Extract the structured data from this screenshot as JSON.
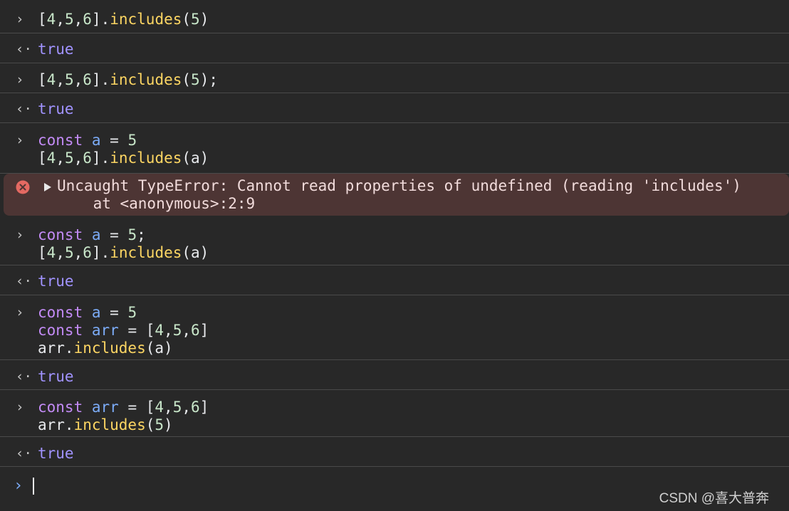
{
  "entries": [
    {
      "type": "input",
      "lines": [
        [
          {
            "t": "[",
            "c": "plain"
          },
          {
            "t": "4",
            "c": "num"
          },
          {
            "t": ",",
            "c": "plain"
          },
          {
            "t": "5",
            "c": "num"
          },
          {
            "t": ",",
            "c": "plain"
          },
          {
            "t": "6",
            "c": "num"
          },
          {
            "t": "].",
            "c": "plain"
          },
          {
            "t": "includes",
            "c": "fn"
          },
          {
            "t": "(",
            "c": "plain"
          },
          {
            "t": "5",
            "c": "num"
          },
          {
            "t": ")",
            "c": "plain"
          }
        ]
      ]
    },
    {
      "type": "result",
      "lines": [
        [
          {
            "t": "true",
            "c": "bool"
          }
        ]
      ]
    },
    {
      "type": "input",
      "lines": [
        [
          {
            "t": "[",
            "c": "plain"
          },
          {
            "t": "4",
            "c": "num"
          },
          {
            "t": ",",
            "c": "plain"
          },
          {
            "t": "5",
            "c": "num"
          },
          {
            "t": ",",
            "c": "plain"
          },
          {
            "t": "6",
            "c": "num"
          },
          {
            "t": "].",
            "c": "plain"
          },
          {
            "t": "includes",
            "c": "fn"
          },
          {
            "t": "(",
            "c": "plain"
          },
          {
            "t": "5",
            "c": "num"
          },
          {
            "t": ");",
            "c": "plain"
          }
        ]
      ]
    },
    {
      "type": "result",
      "lines": [
        [
          {
            "t": "true",
            "c": "bool"
          }
        ]
      ]
    },
    {
      "type": "input",
      "lines": [
        [
          {
            "t": "const",
            "c": "kw"
          },
          {
            "t": " ",
            "c": "plain"
          },
          {
            "t": "a",
            "c": "var"
          },
          {
            "t": " = ",
            "c": "plain"
          },
          {
            "t": "5",
            "c": "num"
          }
        ],
        [
          {
            "t": "[",
            "c": "plain"
          },
          {
            "t": "4",
            "c": "num"
          },
          {
            "t": ",",
            "c": "plain"
          },
          {
            "t": "5",
            "c": "num"
          },
          {
            "t": ",",
            "c": "plain"
          },
          {
            "t": "6",
            "c": "num"
          },
          {
            "t": "].",
            "c": "plain"
          },
          {
            "t": "includes",
            "c": "fn"
          },
          {
            "t": "(a)",
            "c": "plain"
          }
        ]
      ]
    },
    {
      "type": "error",
      "lines": [
        "Uncaught TypeError: Cannot read properties of undefined (reading 'includes')",
        "    at <anonymous>:2:9"
      ]
    },
    {
      "type": "input",
      "lines": [
        [
          {
            "t": "const",
            "c": "kw"
          },
          {
            "t": " ",
            "c": "plain"
          },
          {
            "t": "a",
            "c": "var"
          },
          {
            "t": " = ",
            "c": "plain"
          },
          {
            "t": "5",
            "c": "num"
          },
          {
            "t": ";",
            "c": "plain"
          }
        ],
        [
          {
            "t": "[",
            "c": "plain"
          },
          {
            "t": "4",
            "c": "num"
          },
          {
            "t": ",",
            "c": "plain"
          },
          {
            "t": "5",
            "c": "num"
          },
          {
            "t": ",",
            "c": "plain"
          },
          {
            "t": "6",
            "c": "num"
          },
          {
            "t": "].",
            "c": "plain"
          },
          {
            "t": "includes",
            "c": "fn"
          },
          {
            "t": "(a)",
            "c": "plain"
          }
        ]
      ]
    },
    {
      "type": "result",
      "lines": [
        [
          {
            "t": "true",
            "c": "bool"
          }
        ]
      ]
    },
    {
      "type": "input",
      "lines": [
        [
          {
            "t": "const",
            "c": "kw"
          },
          {
            "t": " ",
            "c": "plain"
          },
          {
            "t": "a",
            "c": "var"
          },
          {
            "t": " = ",
            "c": "plain"
          },
          {
            "t": "5",
            "c": "num"
          }
        ],
        [
          {
            "t": "const",
            "c": "kw"
          },
          {
            "t": " ",
            "c": "plain"
          },
          {
            "t": "arr",
            "c": "var"
          },
          {
            "t": " = [",
            "c": "plain"
          },
          {
            "t": "4",
            "c": "num"
          },
          {
            "t": ",",
            "c": "plain"
          },
          {
            "t": "5",
            "c": "num"
          },
          {
            "t": ",",
            "c": "plain"
          },
          {
            "t": "6",
            "c": "num"
          },
          {
            "t": "]",
            "c": "plain"
          }
        ],
        [
          {
            "t": "arr.",
            "c": "plain"
          },
          {
            "t": "includes",
            "c": "fn"
          },
          {
            "t": "(a)",
            "c": "plain"
          }
        ]
      ]
    },
    {
      "type": "result",
      "lines": [
        [
          {
            "t": "true",
            "c": "bool"
          }
        ]
      ]
    },
    {
      "type": "input",
      "lines": [
        [
          {
            "t": "const",
            "c": "kw"
          },
          {
            "t": " ",
            "c": "plain"
          },
          {
            "t": "arr",
            "c": "var"
          },
          {
            "t": " = [",
            "c": "plain"
          },
          {
            "t": "4",
            "c": "num"
          },
          {
            "t": ",",
            "c": "plain"
          },
          {
            "t": "5",
            "c": "num"
          },
          {
            "t": ",",
            "c": "plain"
          },
          {
            "t": "6",
            "c": "num"
          },
          {
            "t": "]",
            "c": "plain"
          }
        ],
        [
          {
            "t": "arr.",
            "c": "plain"
          },
          {
            "t": "includes",
            "c": "fn"
          },
          {
            "t": "(",
            "c": "plain"
          },
          {
            "t": "5",
            "c": "num"
          },
          {
            "t": ")",
            "c": "plain"
          }
        ]
      ]
    },
    {
      "type": "result",
      "lines": [
        [
          {
            "t": "true",
            "c": "bool"
          }
        ]
      ]
    }
  ],
  "prompt_symbol": "›",
  "result_symbol": "‹·",
  "watermark": "CSDN @喜大普奔",
  "colors": {
    "background": "#282828",
    "keyword": "#c38bf6",
    "variable": "#7cacf8",
    "number": "#c8e6c9",
    "function": "#fdd663",
    "boolean": "#a193ff",
    "error_bg": "#4d3534",
    "error_icon": "#e46962"
  },
  "icons": {
    "input": "chevron-right-icon",
    "result": "return-arrow-icon",
    "error": "error-circle-icon",
    "disclosure": "triangle-right-icon"
  }
}
